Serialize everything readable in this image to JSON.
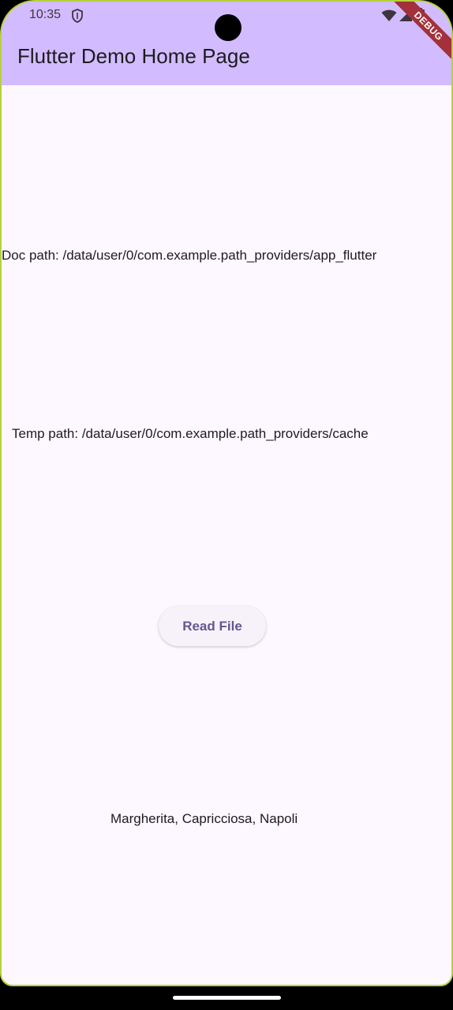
{
  "status_bar": {
    "time": "10:35",
    "icons": [
      "shield-icon",
      "wifi-icon",
      "signal-icon",
      "battery-icon"
    ]
  },
  "debug_banner": "DEBUG",
  "app_bar": {
    "title": "Flutter Demo Home Page",
    "background": "#d2bcff"
  },
  "main": {
    "doc_path_text": "Doc path: /data/user/0/com.example.path_providers/app_flutter",
    "temp_path_text": "Temp path: /data/user/0/com.example.path_providers/cache",
    "read_button_label": "Read File",
    "file_contents": "Margherita, Capricciosa, Napoli"
  },
  "colors": {
    "page_background": "#fdf7ff",
    "accent": "#65558f",
    "debug_ribbon": "#a3303a"
  }
}
